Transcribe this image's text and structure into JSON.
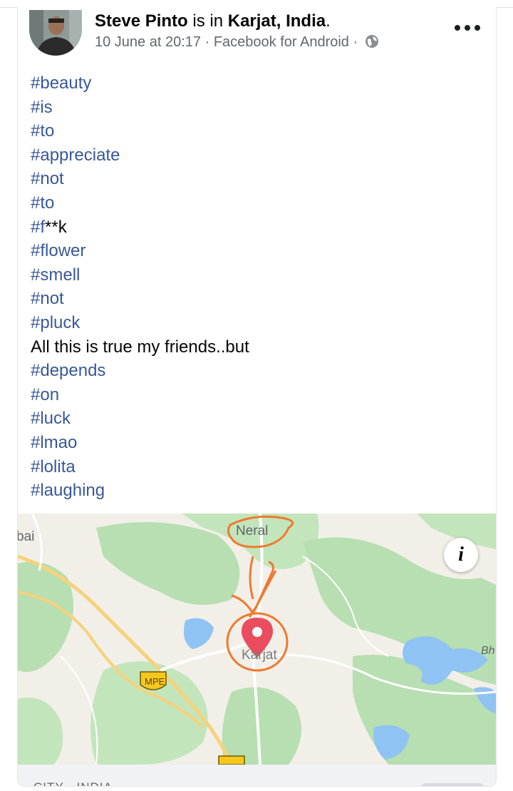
{
  "post": {
    "author": "Steve Pinto",
    "is_in": "is in",
    "location": "Karjat, India",
    "end_period": ".",
    "date": "10 June at 20:17",
    "separator": "·",
    "source": "Facebook for Android",
    "privacy_icon": "globe-icon",
    "more_icon": "more-dots-icon",
    "lines": [
      "#beauty",
      "#is",
      "#to",
      "#appreciate",
      "#not",
      "#to",
      "#f**k",
      "#flower",
      "#smell",
      "#not",
      "#pluck",
      "All this is true my friends..but",
      "#depends",
      "#on",
      "#luck",
      "#lmao",
      "#lolita",
      "#laughing"
    ]
  },
  "map": {
    "labels": {
      "bai": "bai",
      "neral": "Neral",
      "karjat": "Karjat",
      "mpe": "MPE",
      "bh": "Bh"
    },
    "info_button": "i",
    "pin_icon": "location-pin-icon"
  },
  "footer": {
    "text": "CITY · INDIA"
  },
  "colors": {
    "hashtag": "#385898",
    "text": "#050505",
    "meta": "#65676b",
    "map_base": "#f2efe9",
    "map_green": "#b7dfb1",
    "map_water": "#8fc3f3",
    "pin": "#ea4d5f",
    "annotation": "#ef7a2e",
    "highway_shield": "#f6c81f"
  }
}
